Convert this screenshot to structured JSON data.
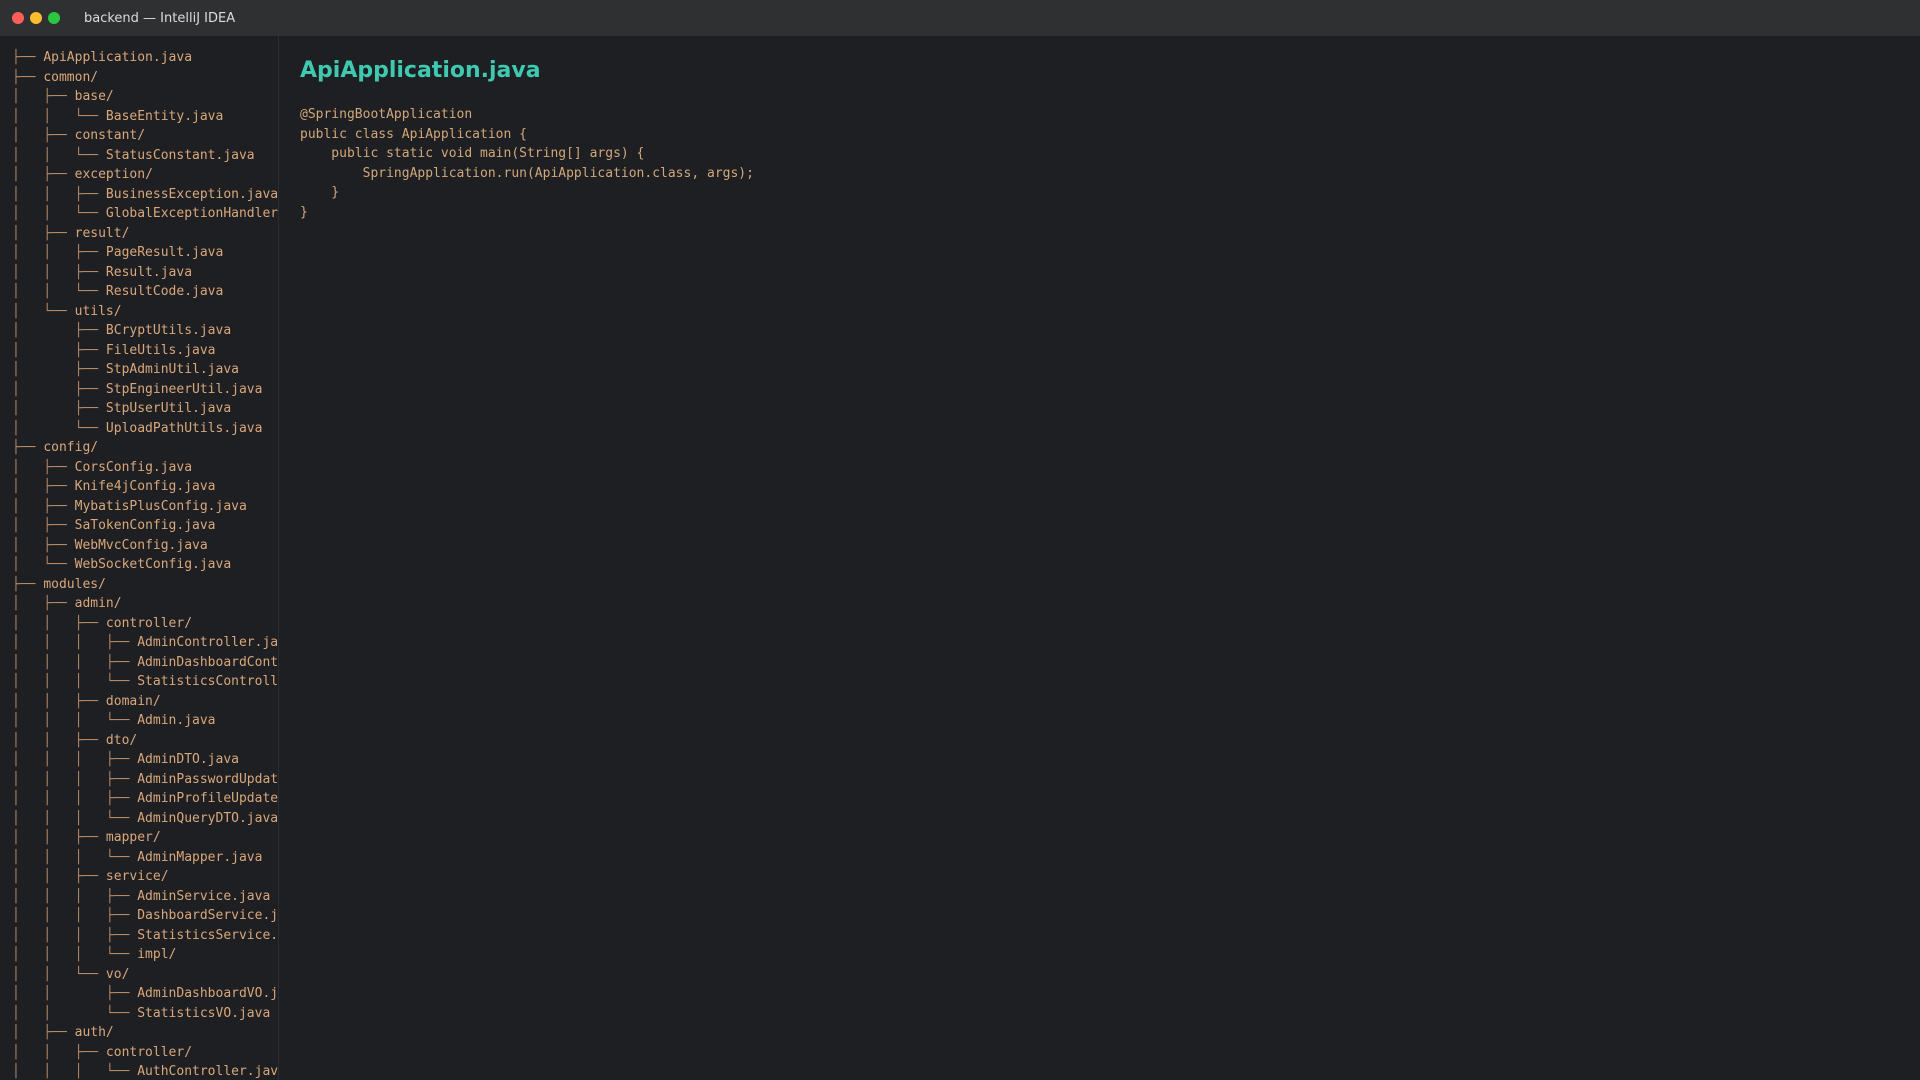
{
  "window": {
    "title": "backend — IntelliJ IDEA"
  },
  "icons": {
    "close": "close-dot",
    "minimize": "minimize-dot",
    "maximize": "maximize-dot"
  },
  "colors": {
    "accent": "#3ec9b0",
    "text": "#d2a77a",
    "background": "#1e1f22",
    "titlebar": "#2f3031"
  },
  "sidebar": {
    "tree": [
      {
        "prefix": "├── ",
        "name": "ApiApplication.java"
      },
      {
        "prefix": "├── ",
        "name": "common/"
      },
      {
        "prefix": "│   ├── ",
        "name": "base/"
      },
      {
        "prefix": "│   │   └── ",
        "name": "BaseEntity.java"
      },
      {
        "prefix": "│   ├── ",
        "name": "constant/"
      },
      {
        "prefix": "│   │   └── ",
        "name": "StatusConstant.java"
      },
      {
        "prefix": "│   ├── ",
        "name": "exception/"
      },
      {
        "prefix": "│   │   ├── ",
        "name": "BusinessException.java"
      },
      {
        "prefix": "│   │   └── ",
        "name": "GlobalExceptionHandler"
      },
      {
        "prefix": "│   ├── ",
        "name": "result/"
      },
      {
        "prefix": "│   │   ├── ",
        "name": "PageResult.java"
      },
      {
        "prefix": "│   │   ├── ",
        "name": "Result.java"
      },
      {
        "prefix": "│   │   └── ",
        "name": "ResultCode.java"
      },
      {
        "prefix": "│   └── ",
        "name": "utils/"
      },
      {
        "prefix": "│       ├── ",
        "name": "BCryptUtils.java"
      },
      {
        "prefix": "│       ├── ",
        "name": "FileUtils.java"
      },
      {
        "prefix": "│       ├── ",
        "name": "StpAdminUtil.java"
      },
      {
        "prefix": "│       ├── ",
        "name": "StpEngineerUtil.java"
      },
      {
        "prefix": "│       ├── ",
        "name": "StpUserUtil.java"
      },
      {
        "prefix": "│       └── ",
        "name": "UploadPathUtils.java"
      },
      {
        "prefix": "├── ",
        "name": "config/"
      },
      {
        "prefix": "│   ├── ",
        "name": "CorsConfig.java"
      },
      {
        "prefix": "│   ├── ",
        "name": "Knife4jConfig.java"
      },
      {
        "prefix": "│   ├── ",
        "name": "MybatisPlusConfig.java"
      },
      {
        "prefix": "│   ├── ",
        "name": "SaTokenConfig.java"
      },
      {
        "prefix": "│   ├── ",
        "name": "WebMvcConfig.java"
      },
      {
        "prefix": "│   └── ",
        "name": "WebSocketConfig.java"
      },
      {
        "prefix": "├── ",
        "name": "modules/"
      },
      {
        "prefix": "│   ├── ",
        "name": "admin/"
      },
      {
        "prefix": "│   │   ├── ",
        "name": "controller/"
      },
      {
        "prefix": "│   │   │   ├── ",
        "name": "AdminController.ja"
      },
      {
        "prefix": "│   │   │   ├── ",
        "name": "AdminDashboardCont"
      },
      {
        "prefix": "│   │   │   └── ",
        "name": "StatisticsControll"
      },
      {
        "prefix": "│   │   ├── ",
        "name": "domain/"
      },
      {
        "prefix": "│   │   │   └── ",
        "name": "Admin.java"
      },
      {
        "prefix": "│   │   ├── ",
        "name": "dto/"
      },
      {
        "prefix": "│   │   │   ├── ",
        "name": "AdminDTO.java"
      },
      {
        "prefix": "│   │   │   ├── ",
        "name": "AdminPasswordUpdat"
      },
      {
        "prefix": "│   │   │   ├── ",
        "name": "AdminProfileUpdate"
      },
      {
        "prefix": "│   │   │   └── ",
        "name": "AdminQueryDTO.java"
      },
      {
        "prefix": "│   │   ├── ",
        "name": "mapper/"
      },
      {
        "prefix": "│   │   │   └── ",
        "name": "AdminMapper.java"
      },
      {
        "prefix": "│   │   ├── ",
        "name": "service/"
      },
      {
        "prefix": "│   │   │   ├── ",
        "name": "AdminService.java"
      },
      {
        "prefix": "│   │   │   ├── ",
        "name": "DashboardService.j"
      },
      {
        "prefix": "│   │   │   ├── ",
        "name": "StatisticsService."
      },
      {
        "prefix": "│   │   │   └── ",
        "name": "impl/"
      },
      {
        "prefix": "│   │   └── ",
        "name": "vo/"
      },
      {
        "prefix": "│   │       ├── ",
        "name": "AdminDashboardVO.j"
      },
      {
        "prefix": "│   │       └── ",
        "name": "StatisticsVO.java"
      },
      {
        "prefix": "│   ├── ",
        "name": "auth/"
      },
      {
        "prefix": "│   │   ├── ",
        "name": "controller/"
      },
      {
        "prefix": "│   │   │   └── ",
        "name": "AuthController.jav"
      }
    ]
  },
  "editor": {
    "file_title": "ApiApplication.java",
    "code_lines": [
      "@SpringBootApplication",
      "public class ApiApplication {",
      "    public static void main(String[] args) {",
      "        SpringApplication.run(ApiApplication.class, args);",
      "    }",
      "}"
    ]
  }
}
